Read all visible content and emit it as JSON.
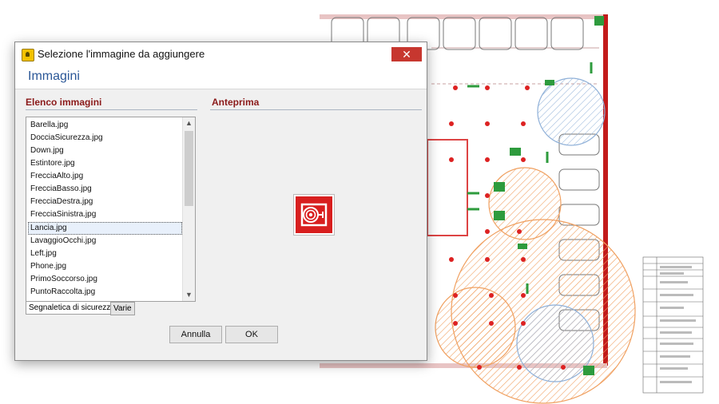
{
  "dialog": {
    "title": "Selezione l'immagine da aggiungere",
    "close_label": "✕",
    "header": "Immagini",
    "list_section_title": "Elenco immagini",
    "preview_section_title": "Anteprima",
    "items": [
      "Barella.jpg",
      "DocciaSicurezza.jpg",
      "Down.jpg",
      "Estintore.jpg",
      "FrecciaAlto.jpg",
      "FrecciaBasso.jpg",
      "FrecciaDestra.jpg",
      "FrecciaSinistra.jpg",
      "Lancia.jpg",
      "LavaggioOcchi.jpg",
      "Left.jpg",
      "Phone.jpg",
      "PrimoSoccorso.jpg",
      "PuntoRaccolta.jpg"
    ],
    "selected_item": "Lancia.jpg",
    "tabs": [
      "Segnaletica di sicurezza",
      "Varie"
    ],
    "active_tab": "Segnaletica di sicurezza",
    "cancel_label": "Annulla",
    "ok_label": "OK"
  },
  "colors": {
    "accent_title": "#2b5797",
    "section_title": "#8b1a1a",
    "close_button": "#c7372f",
    "preview_red": "#d81e1e"
  },
  "icons": {
    "preview": "fire-hose-icon"
  }
}
